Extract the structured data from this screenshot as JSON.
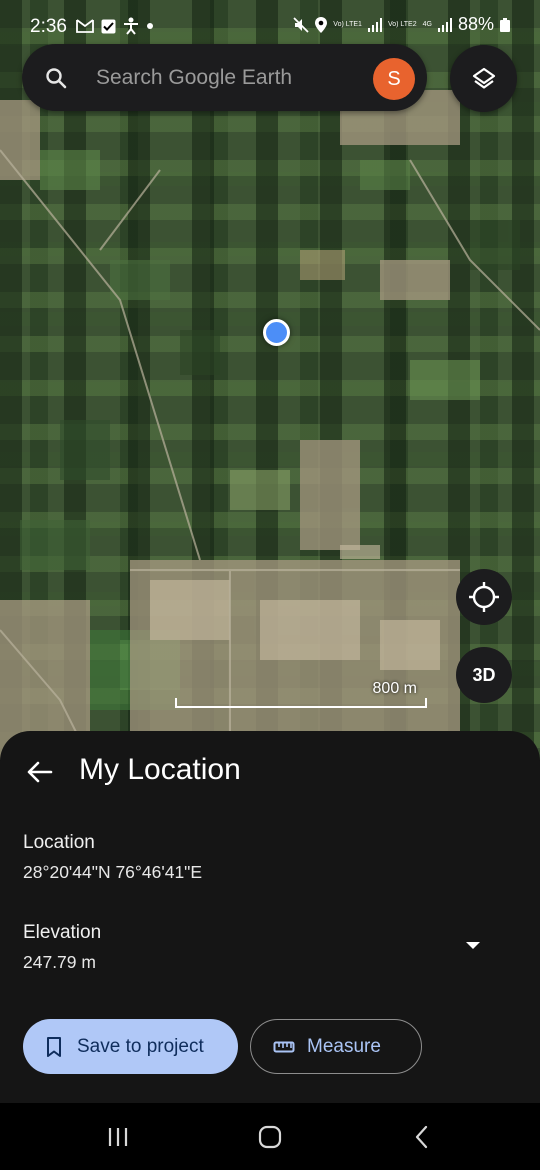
{
  "status_bar": {
    "time": "2:36",
    "left_icons": [
      "gmail-icon",
      "checkbox-icon",
      "accessibility-icon",
      "dot-icon"
    ],
    "sim1_label": "Vo) LTE1",
    "sim2_label": "Vo) LTE2",
    "network_type": "4G",
    "battery": "88%"
  },
  "search": {
    "placeholder": "Search Google Earth",
    "avatar_letter": "S",
    "avatar_color": "#e8632e"
  },
  "map": {
    "scale_label": "800 m",
    "three_d_label": "3D",
    "location_dot_color": "#4c8ef7"
  },
  "sheet": {
    "title": "My Location",
    "location_label": "Location",
    "location_value": "28°20'44\"N 76°46'41\"E",
    "elevation_label": "Elevation",
    "elevation_value": "247.79 m",
    "save_label": "Save to project",
    "measure_label": "Measure"
  },
  "colors": {
    "sheet_bg": "#151515",
    "primary_button_bg": "#b0c8f7",
    "accent_text": "#aac4f5"
  }
}
